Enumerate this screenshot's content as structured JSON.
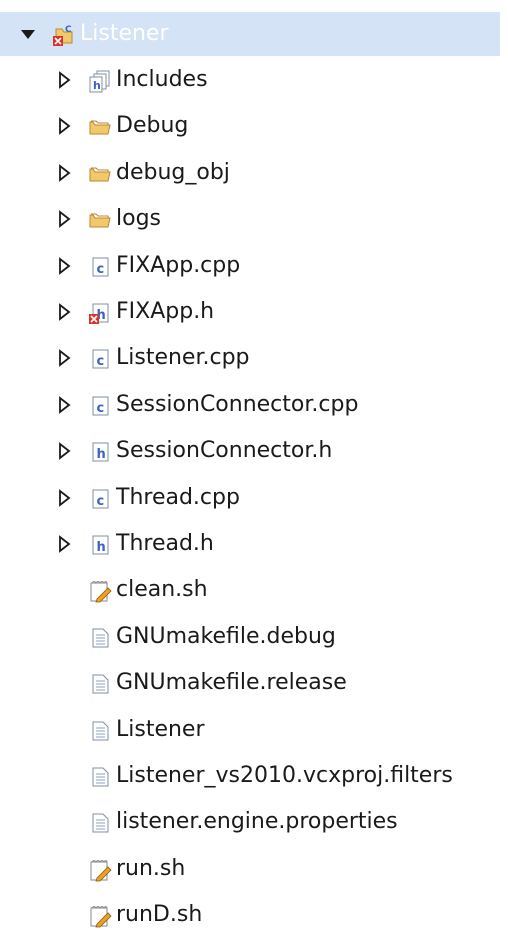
{
  "tree": {
    "root": {
      "label": "Listener",
      "expanded": true,
      "icon": "c-project-error-icon"
    },
    "children": [
      {
        "label": "Includes",
        "icon": "includes-icon",
        "expandable": true
      },
      {
        "label": "Debug",
        "icon": "folder-icon",
        "expandable": true
      },
      {
        "label": "debug_obj",
        "icon": "folder-icon",
        "expandable": true
      },
      {
        "label": "logs",
        "icon": "folder-icon",
        "expandable": true
      },
      {
        "label": "FIXApp.cpp",
        "icon": "c-source-file-icon",
        "expandable": true
      },
      {
        "label": "FIXApp.h",
        "icon": "header-file-error-icon",
        "expandable": true
      },
      {
        "label": "Listener.cpp",
        "icon": "c-source-file-icon",
        "expandable": true
      },
      {
        "label": "SessionConnector.cpp",
        "icon": "c-source-file-icon",
        "expandable": true
      },
      {
        "label": "SessionConnector.h",
        "icon": "header-file-icon",
        "expandable": true
      },
      {
        "label": "Thread.cpp",
        "icon": "c-source-file-icon",
        "expandable": true
      },
      {
        "label": "Thread.h",
        "icon": "header-file-icon",
        "expandable": true
      },
      {
        "label": "clean.sh",
        "icon": "script-file-icon",
        "expandable": false
      },
      {
        "label": "GNUmakefile.debug",
        "icon": "text-file-icon",
        "expandable": false
      },
      {
        "label": "GNUmakefile.release",
        "icon": "text-file-icon",
        "expandable": false
      },
      {
        "label": "Listener",
        "icon": "text-file-icon",
        "expandable": false
      },
      {
        "label": "Listener_vs2010.vcxproj.filters",
        "icon": "text-file-icon",
        "expandable": false
      },
      {
        "label": "listener.engine.properties",
        "icon": "text-file-icon",
        "expandable": false
      },
      {
        "label": "run.sh",
        "icon": "script-file-icon",
        "expandable": false
      },
      {
        "label": "runD.sh",
        "icon": "script-file-icon",
        "expandable": false
      }
    ]
  },
  "colors": {
    "selection": "#d4e3f6",
    "root_label": "#ffffff",
    "text": "#1a1a1a",
    "folder": "#f2c96a",
    "error": "#d9342b",
    "c_letter": "#3a63c4",
    "h_letter": "#3a63c4"
  }
}
